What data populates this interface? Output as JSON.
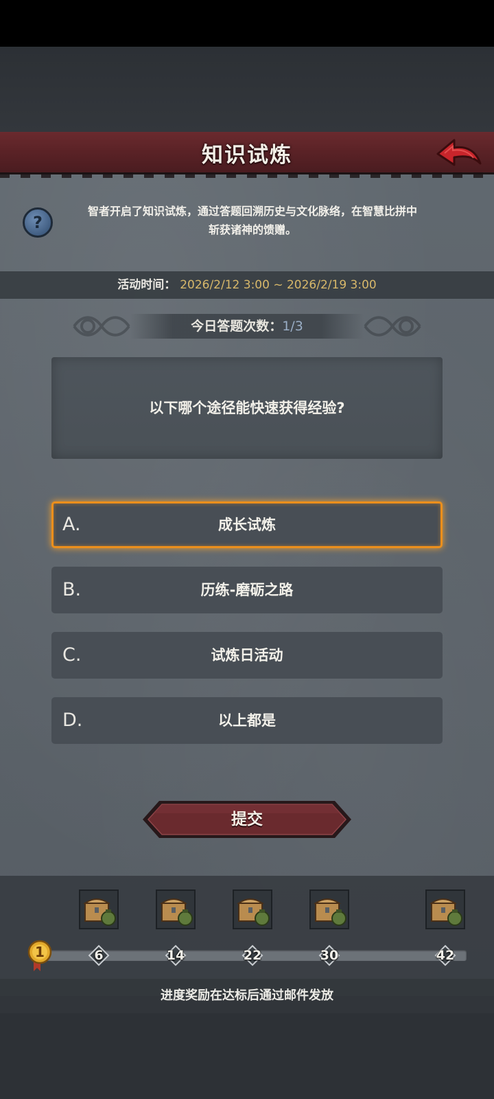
{
  "header": {
    "title": "知识试炼"
  },
  "intro": {
    "text_line1": "智者开启了知识试炼，通过答题回溯历史与文化脉络，在智慧比拼中",
    "text_line2": "斩获诸神的馈赠。"
  },
  "event_time": {
    "label": "活动时间：",
    "value": "2026/2/12 3:00 ~ 2026/2/19 3:00"
  },
  "attempts": {
    "label": "今日答题次数：",
    "value": "1/3"
  },
  "question": {
    "text": "以下哪个途径能快速获得经验?"
  },
  "options": [
    {
      "letter": "A.",
      "text": "成长试炼",
      "selected": true
    },
    {
      "letter": "B.",
      "text": "历练-磨砺之路",
      "selected": false
    },
    {
      "letter": "C.",
      "text": "试炼日活动",
      "selected": false
    },
    {
      "letter": "D.",
      "text": "以上都是",
      "selected": false
    }
  ],
  "submit": {
    "label": "提交"
  },
  "progress": {
    "current": "1",
    "milestones": [
      "6",
      "14",
      "22",
      "30",
      "42"
    ],
    "reward_icon": "treasure-chest-and-money-bag-icon"
  },
  "footer": {
    "note": "进度奖励在达标后通过邮件发放"
  },
  "colors": {
    "accent_red": "#5a2226",
    "selected_border": "#ec8f1c",
    "date_gold": "#d8b86a",
    "count_blue": "#9aaec6"
  }
}
